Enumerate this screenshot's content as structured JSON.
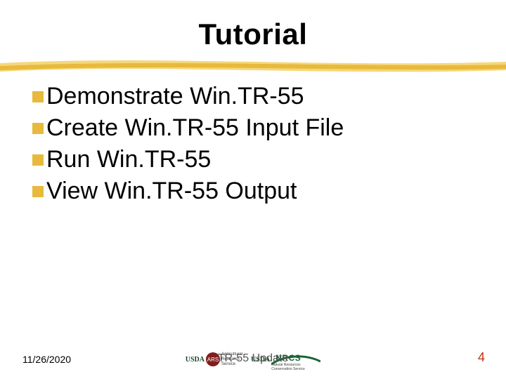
{
  "title": "Tutorial",
  "bullets": [
    {
      "text": "Demonstrate Win.TR-55"
    },
    {
      "text": "Create Win.TR-55 Input File"
    },
    {
      "text": "Run Win.TR-55"
    },
    {
      "text": "View Win.TR-55 Output"
    }
  ],
  "footer": {
    "date": "11/26/2020",
    "center_text": "TR-55 Update",
    "page": "4"
  },
  "logos": {
    "usda": "USDA",
    "ars_circle": "ARS",
    "ars_line1": "Agricultural",
    "ars_line2": "Research",
    "ars_line3": "Service",
    "nrcs": "NRCS",
    "nrcs_sub": "Natural Resources Conservation Service",
    "usda2": "USDA"
  },
  "colors": {
    "swoosh_light": "#f6d77a",
    "swoosh_dark": "#e7b93d",
    "bullet": "#e7b93d",
    "page_number": "#c03010"
  }
}
